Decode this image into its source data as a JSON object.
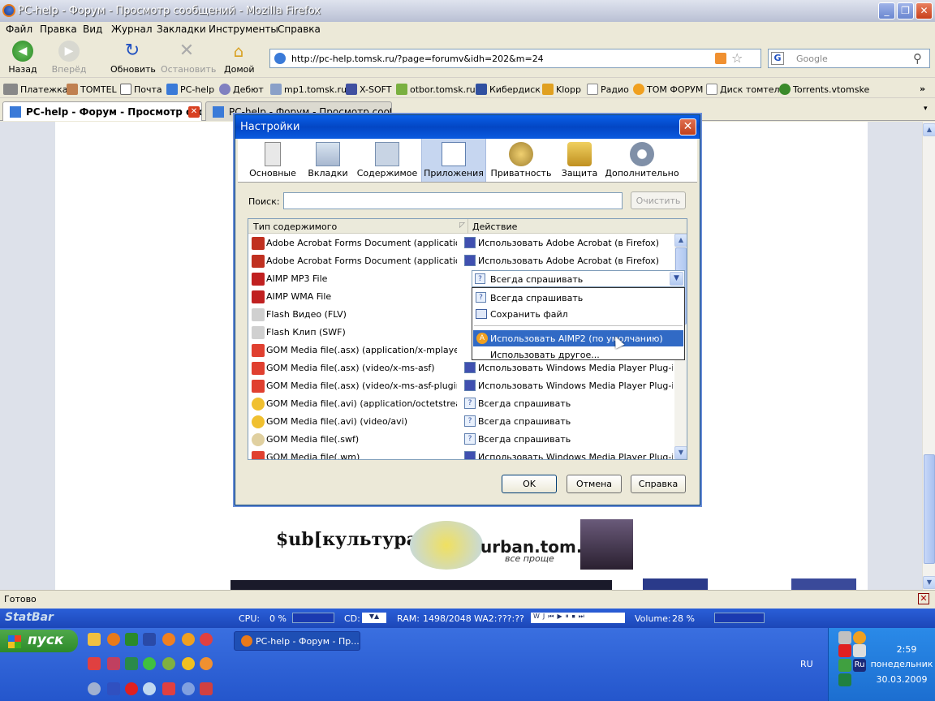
{
  "window": {
    "title": "PC-help - Форум - Просмотр сообщений - Mozilla Firefox"
  },
  "menu": [
    "Файл",
    "Правка",
    "Вид",
    "Журнал",
    "Закладки",
    "Инструменты",
    "Справка"
  ],
  "nav": {
    "back": "Назад",
    "forward": "Вперёд",
    "reload": "Обновить",
    "stop": "Остановить",
    "home": "Домой"
  },
  "url": "http://pc-help.tomsk.ru/?page=forumv&idh=202&m=24",
  "search_placeholder": "Google",
  "bookmarks": [
    "Платежка",
    "TOMTEL",
    "Почта",
    "PC-help",
    "Дебют",
    "mp1.tomsk.ru",
    "X-SOFT",
    "otbor.tomsk.ru",
    "Кибердиск",
    "Klopp",
    "Радио",
    "ТОМ ФОРУМ",
    "Диск томтел",
    "Torrents.vtomske"
  ],
  "tabs": [
    {
      "label": "PC-help - Форум - Просмотр соо...",
      "active": true
    },
    {
      "label": "PC-help - Форум - Просмотр сообщений",
      "active": false
    }
  ],
  "dialog": {
    "title": "Настройки",
    "panes": [
      "Основные",
      "Вкладки",
      "Содержимое",
      "Приложения",
      "Приватность",
      "Защита",
      "Дополнительно"
    ],
    "selected_pane": "Приложения",
    "search_label": "Поиск:",
    "clear_label": "Очистить",
    "col_type": "Тип содержимого",
    "col_action": "Действие",
    "rows": [
      {
        "type": "Adobe Acrobat Forms Document (application/v...",
        "action": "Использовать Adobe Acrobat (в Firefox)"
      },
      {
        "type": "Adobe Acrobat Forms Document (application/v...",
        "action": "Использовать Adobe Acrobat (в Firefox)"
      },
      {
        "type": "AIMP MP3 File",
        "action": ""
      },
      {
        "type": "AIMP WMA File",
        "action": ""
      },
      {
        "type": "Flash Видео (FLV)",
        "action": ""
      },
      {
        "type": "Flash Клип (SWF)",
        "action": ""
      },
      {
        "type": "GOM Media file(.asx) (application/x-mplayer2)",
        "action": ""
      },
      {
        "type": "GOM Media file(.asx) (video/x-ms-asf)",
        "action": "Использовать Windows Media Player Plug-in ..."
      },
      {
        "type": "GOM Media file(.asx) (video/x-ms-asf-plugin)",
        "action": "Использовать Windows Media Player Plug-in ..."
      },
      {
        "type": "GOM Media file(.avi) (application/octetstream)",
        "action": "Всегда спрашивать"
      },
      {
        "type": "GOM Media file(.avi) (video/avi)",
        "action": "Всегда спрашивать"
      },
      {
        "type": "GOM Media file(.swf)",
        "action": "Всегда спрашивать"
      },
      {
        "type": "GOM Media file(.wm)",
        "action": "Использовать Windows Media Player Plug-in ..."
      }
    ],
    "combo_value": "Всегда спрашивать",
    "popup_items": [
      "Всегда спрашивать",
      "Сохранить файл",
      "Использовать AIMP2 (по умолчанию)",
      "Использовать другое..."
    ],
    "popup_highlight": 2,
    "ok": "OK",
    "cancel": "Отмена",
    "help": "Справка"
  },
  "banner": {
    "left": "$ub[культура]",
    "right": "urban.tom.ru",
    "tagline": "все проще"
  },
  "status": "Готово",
  "statbar": {
    "name": "StatBar",
    "cpu": "CPU:",
    "cpu_val": "0 %",
    "cd": "CD:",
    "ram": "RAM:",
    "ram_val": "1498/2048",
    "wa": "WA2:",
    "wa_val": "???:??",
    "volume": "Volume:",
    "volume_val": "28 %"
  },
  "taskbar": {
    "start": "пуск",
    "task": "PC-help - Форум - Пр...",
    "lang": "RU",
    "time": "2:59",
    "day": "понедельник",
    "date": "30.03.2009"
  }
}
